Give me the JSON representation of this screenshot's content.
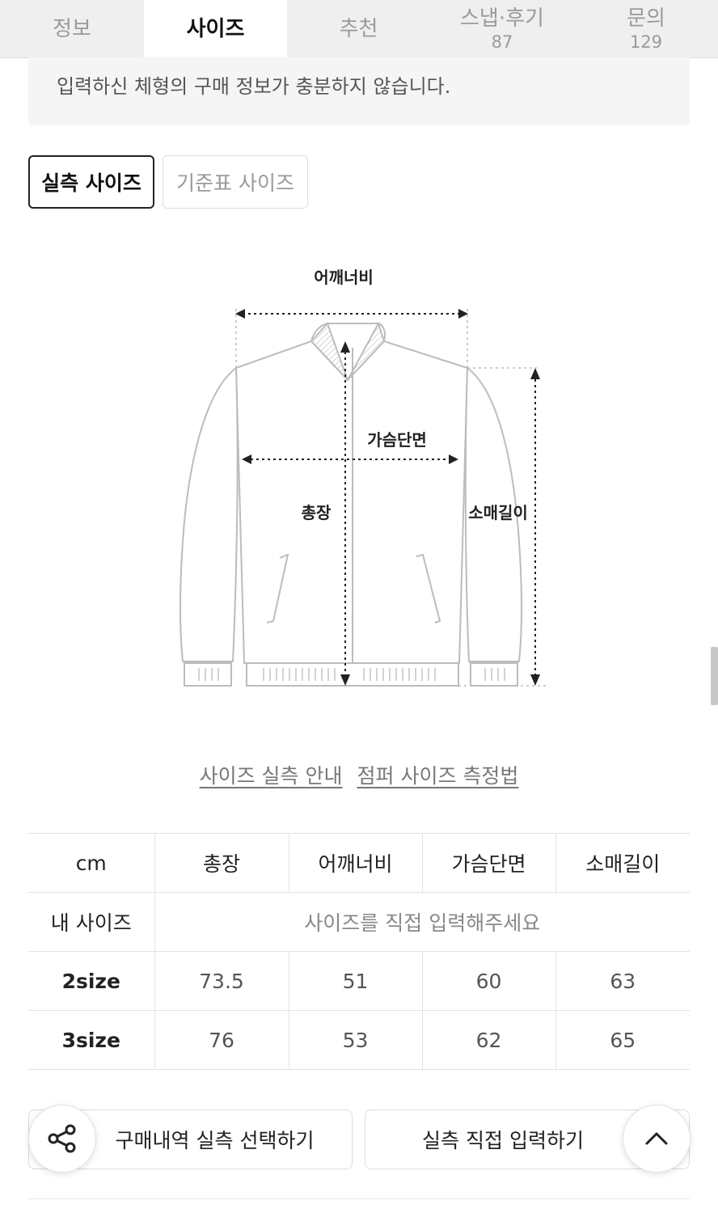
{
  "tabs": [
    {
      "label": "정보",
      "count": "",
      "active": false
    },
    {
      "label": "사이즈",
      "count": "",
      "active": true
    },
    {
      "label": "추천",
      "count": "",
      "active": false
    },
    {
      "label": "스냅·후기",
      "count": "87",
      "active": false
    },
    {
      "label": "문의",
      "count": "129",
      "active": false
    }
  ],
  "notice": "입력하신 체형의 구매 정보가 충분하지 않습니다.",
  "size_toggle": {
    "actual": "실측 사이즈",
    "standard": "기준표 사이즈"
  },
  "diagram": {
    "shoulder": "어깨너비",
    "chest": "가슴단면",
    "length": "총장",
    "sleeve": "소매길이"
  },
  "links": {
    "guide": "사이즈 실측 안내",
    "method": "점퍼 사이즈 측정법"
  },
  "table": {
    "unit": "cm",
    "headers": [
      "총장",
      "어깨너비",
      "가슴단면",
      "소매길이"
    ],
    "my_size": {
      "label": "내 사이즈",
      "hint": "사이즈를 직접 입력해주세요"
    },
    "rows": [
      {
        "size": "2size",
        "values": [
          "73.5",
          "51",
          "60",
          "63"
        ]
      },
      {
        "size": "3size",
        "values": [
          "76",
          "53",
          "62",
          "65"
        ]
      }
    ]
  },
  "actions": {
    "purchase": "구매내역 실측 선택하기",
    "manual": "실측 직접 입력하기"
  },
  "icons": {
    "share": "share-icon",
    "top": "chevron-up-icon"
  }
}
